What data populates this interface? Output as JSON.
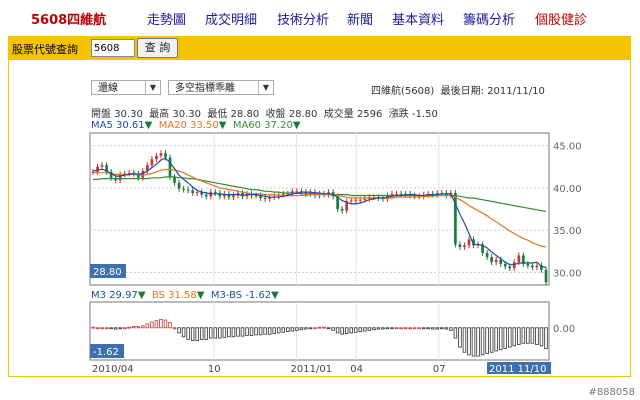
{
  "nav": {
    "brand": "5608四維航",
    "items": [
      "走勢圖",
      "成交明細",
      "技術分析",
      "新聞",
      "基本資料",
      "籌碼分析",
      "個股健診"
    ]
  },
  "query": {
    "label": "股票代號查詢",
    "value": "5608",
    "button": "查 詢"
  },
  "controls": {
    "line_type": "還線",
    "indicator": "多空指標乖離"
  },
  "info": {
    "title": "四維航(5608)",
    "last_date_label": "最後日期:",
    "last_date": "2011/11/10",
    "open_label": "開盤",
    "open": "30.30",
    "high_label": "最高",
    "high": "30.30",
    "low_label": "最低",
    "low": "28.80",
    "close_label": "收盤",
    "close": "28.80",
    "volume_label": "成交量",
    "volume": "2596",
    "change_label": "漲跌",
    "change": "-1.50"
  },
  "ma_legend": {
    "ma5_label": "MA5",
    "ma5": "30.61",
    "ma20_label": "MA20",
    "ma20": "33.50",
    "ma60_label": "MA60",
    "ma60": "37.20"
  },
  "indicator_legend": {
    "m3_label": "M3",
    "m3": "29.97",
    "bs_label": "BS",
    "bs": "31.58",
    "diff_label": "M3-BS",
    "diff": "-1.62"
  },
  "colors": {
    "up": "#cc3333",
    "down": "#1d7a3a",
    "ma5": "#1f4fa0",
    "ma20": "#e8741c",
    "ma60": "#3a8a3a",
    "nav_link": "#1a1a9a",
    "brand": "#c00000",
    "bar": "#f5c400",
    "label_box": "#3e6fae"
  },
  "chart_data": {
    "type": "candlestick",
    "price_axis": {
      "ticks": [
        30.0,
        35.0,
        40.0,
        45.0
      ],
      "ylim": [
        28.5,
        46.5
      ]
    },
    "indicator_axis": {
      "ticks": [
        0.0
      ],
      "ylim": [
        -2.5,
        2.0
      ]
    },
    "current_price_label": "28.80",
    "current_indicator_label": "-1.62",
    "x_labels": [
      "2010/04",
      "10",
      "2011/01",
      "04",
      "07",
      "2011 11/10"
    ],
    "closes": [
      41.9,
      42.5,
      42.7,
      41.9,
      41.2,
      40.9,
      41.6,
      41.7,
      41.8,
      41.7,
      41.2,
      42.0,
      42.7,
      43.4,
      43.8,
      44.1,
      43.6,
      41.3,
      40.6,
      39.9,
      39.8,
      39.7,
      39.4,
      39.5,
      39.2,
      39.0,
      39.5,
      39.4,
      39.0,
      39.3,
      38.9,
      39.1,
      39.4,
      39.0,
      39.3,
      39.1,
      39.1,
      38.8,
      38.7,
      38.9,
      39.0,
      39.2,
      39.3,
      39.3,
      39.6,
      39.6,
      39.5,
      39.3,
      39.5,
      39.1,
      39.3,
      39.2,
      39.5,
      39.0,
      37.5,
      37.3,
      38.4,
      38.5,
      38.6,
      38.6,
      38.7,
      38.9,
      38.9,
      38.8,
      38.7,
      39.1,
      39.3,
      39.3,
      39.2,
      39.3,
      39.1,
      39.0,
      39.0,
      39.2,
      39.3,
      39.2,
      39.4,
      39.4,
      39.1,
      39.4,
      33.3,
      33.0,
      33.2,
      33.9,
      33.2,
      33.3,
      32.3,
      31.8,
      31.2,
      31.5,
      31.0,
      30.7,
      30.5,
      31.2,
      32.0,
      31.0,
      30.8,
      30.6,
      30.8,
      30.3,
      28.8
    ],
    "ma5": [
      42.0,
      42.1,
      42.2,
      42.0,
      41.7,
      41.4,
      41.4,
      41.5,
      41.6,
      41.7,
      41.6,
      41.7,
      42.0,
      42.4,
      42.8,
      43.3,
      43.5,
      43.0,
      42.3,
      41.5,
      41.0,
      40.6,
      40.1,
      39.7,
      39.5,
      39.4,
      39.3,
      39.3,
      39.3,
      39.2,
      39.2,
      39.2,
      39.2,
      39.1,
      39.2,
      39.2,
      39.2,
      39.1,
      39.0,
      38.9,
      38.9,
      38.9,
      39.0,
      39.1,
      39.3,
      39.4,
      39.5,
      39.5,
      39.5,
      39.4,
      39.4,
      39.3,
      39.3,
      39.2,
      38.9,
      38.5,
      38.3,
      38.1,
      38.1,
      38.2,
      38.4,
      38.6,
      38.7,
      38.8,
      38.8,
      38.9,
      39.0,
      39.1,
      39.1,
      39.2,
      39.2,
      39.2,
      39.1,
      39.1,
      39.2,
      39.2,
      39.2,
      39.3,
      39.3,
      39.3,
      38.1,
      36.9,
      35.8,
      34.6,
      33.3,
      33.3,
      33.2,
      32.9,
      32.4,
      32.0,
      31.6,
      31.2,
      30.9,
      30.9,
      31.1,
      31.1,
      31.1,
      31.1,
      31.2,
      30.7,
      30.6
    ],
    "ma20": [
      41.8,
      41.8,
      41.8,
      41.8,
      41.7,
      41.6,
      41.6,
      41.6,
      41.6,
      41.6,
      41.5,
      41.5,
      41.6,
      41.7,
      41.9,
      42.1,
      42.2,
      42.2,
      42.1,
      42.0,
      41.8,
      41.5,
      41.3,
      41.0,
      40.8,
      40.6,
      40.4,
      40.2,
      40.0,
      39.9,
      39.8,
      39.7,
      39.6,
      39.5,
      39.4,
      39.3,
      39.3,
      39.3,
      39.2,
      39.2,
      39.2,
      39.1,
      39.1,
      39.1,
      39.1,
      39.1,
      39.1,
      39.1,
      39.2,
      39.2,
      39.2,
      39.2,
      39.2,
      39.2,
      39.1,
      39.0,
      38.9,
      38.8,
      38.8,
      38.8,
      38.8,
      38.8,
      38.8,
      38.8,
      38.8,
      38.8,
      38.8,
      38.9,
      38.9,
      38.9,
      38.9,
      38.9,
      39.0,
      39.0,
      39.0,
      39.0,
      39.1,
      39.1,
      39.1,
      39.1,
      38.9,
      38.6,
      38.3,
      37.9,
      37.6,
      37.3,
      37.0,
      36.7,
      36.3,
      36.0,
      35.6,
      35.3,
      34.9,
      34.6,
      34.3,
      34.0,
      33.8,
      33.5,
      33.3,
      33.1,
      33.0
    ],
    "ma60": [
      41.0,
      41.0,
      41.1,
      41.1,
      41.1,
      41.1,
      41.1,
      41.1,
      41.1,
      41.1,
      41.1,
      41.1,
      41.1,
      41.2,
      41.2,
      41.2,
      41.3,
      41.3,
      41.3,
      41.2,
      41.2,
      41.1,
      41.1,
      41.0,
      40.9,
      40.8,
      40.7,
      40.6,
      40.5,
      40.4,
      40.3,
      40.2,
      40.1,
      40.0,
      39.9,
      39.8,
      39.8,
      39.7,
      39.6,
      39.6,
      39.5,
      39.5,
      39.4,
      39.4,
      39.4,
      39.4,
      39.3,
      39.3,
      39.3,
      39.3,
      39.3,
      39.2,
      39.2,
      39.2,
      39.2,
      39.2,
      39.2,
      39.1,
      39.1,
      39.1,
      39.1,
      39.1,
      39.1,
      39.1,
      39.1,
      39.1,
      39.1,
      39.1,
      39.1,
      39.1,
      39.1,
      39.1,
      39.1,
      39.1,
      39.1,
      39.1,
      39.1,
      39.1,
      39.1,
      39.1,
      39.1,
      39.0,
      38.9,
      38.8,
      38.8,
      38.7,
      38.6,
      38.5,
      38.4,
      38.3,
      38.2,
      38.1,
      38.0,
      37.9,
      37.8,
      37.7,
      37.6,
      37.5,
      37.4,
      37.3,
      37.2
    ],
    "indicator_bars": [
      0.05,
      0.0,
      0.0,
      0.0,
      -0.05,
      -0.1,
      -0.05,
      0.0,
      0.05,
      0.1,
      0.1,
      0.15,
      0.3,
      0.45,
      0.55,
      0.65,
      0.6,
      0.4,
      0.0,
      -0.4,
      -0.7,
      -0.9,
      -1.0,
      -1.0,
      -0.9,
      -0.9,
      -0.8,
      -0.8,
      -0.8,
      -0.75,
      -0.7,
      -0.7,
      -0.65,
      -0.65,
      -0.6,
      -0.6,
      -0.55,
      -0.55,
      -0.5,
      -0.5,
      -0.45,
      -0.4,
      -0.35,
      -0.3,
      -0.25,
      -0.2,
      -0.15,
      -0.1,
      -0.05,
      0.0,
      0.05,
      0.05,
      -0.05,
      -0.2,
      -0.4,
      -0.5,
      -0.45,
      -0.4,
      -0.35,
      -0.3,
      -0.25,
      -0.2,
      -0.15,
      -0.1,
      -0.1,
      -0.05,
      -0.05,
      0.0,
      0.0,
      0.0,
      0.0,
      0.0,
      0.0,
      -0.05,
      -0.05,
      -0.1,
      -0.1,
      -0.05,
      -0.1,
      -0.2,
      -0.8,
      -1.5,
      -1.9,
      -2.1,
      -2.2,
      -2.2,
      -2.1,
      -2.0,
      -1.9,
      -1.8,
      -1.7,
      -1.6,
      -1.5,
      -1.4,
      -1.3,
      -1.2,
      -1.2,
      -1.2,
      -1.3,
      -1.4,
      -1.62
    ]
  }
}
